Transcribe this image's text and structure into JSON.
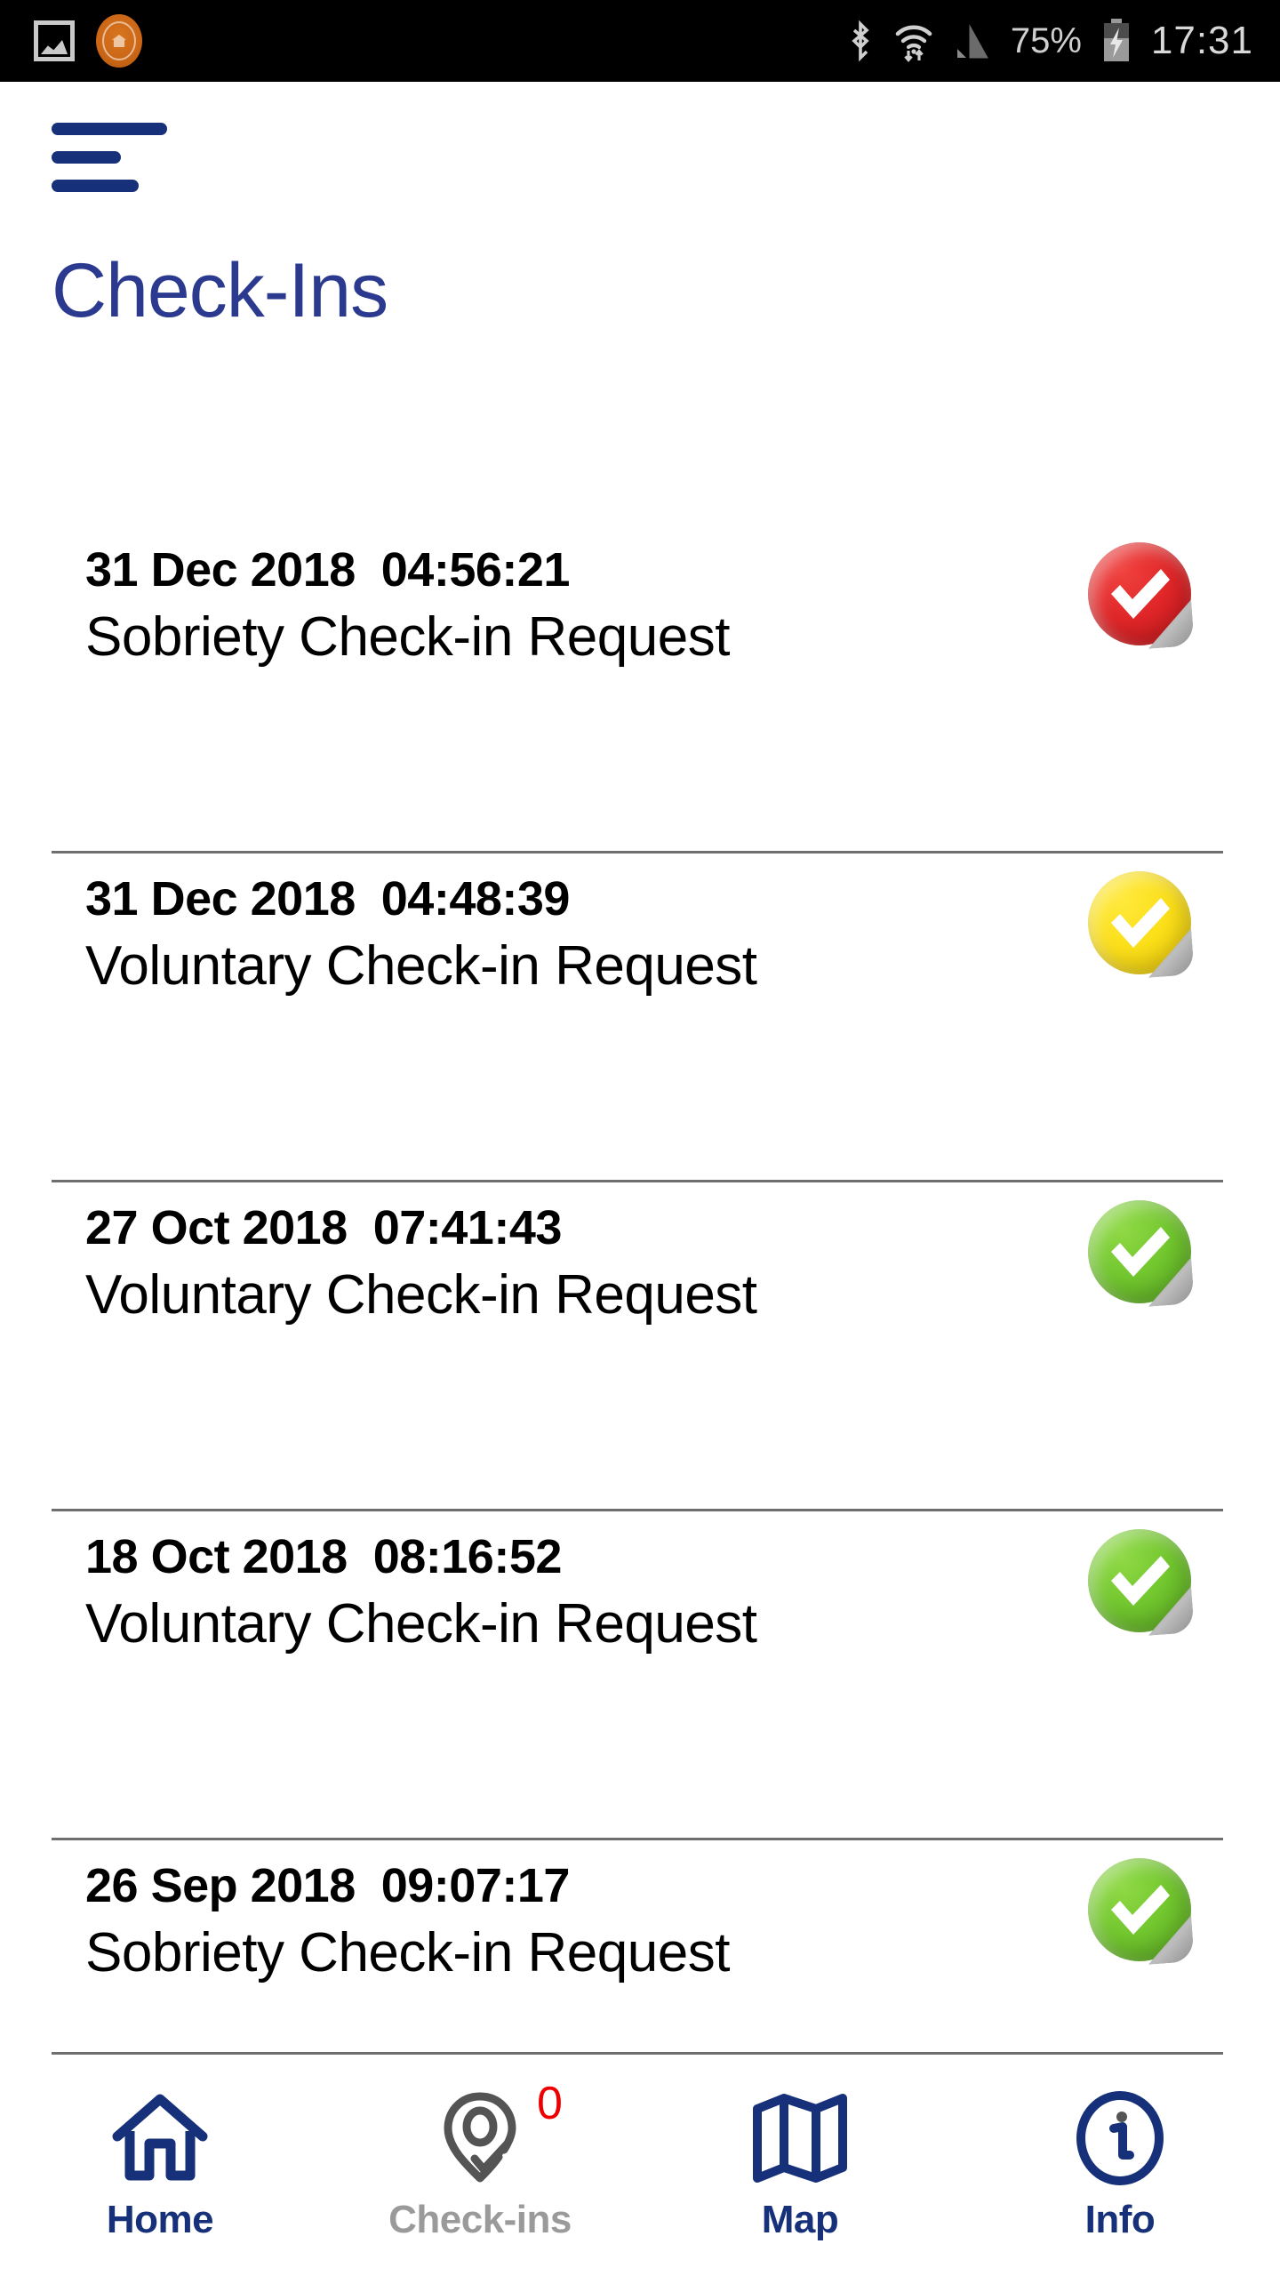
{
  "statusbar": {
    "battery_percent": "75%",
    "clock": "17:31",
    "icons": [
      "screenshot-icon",
      "ecell-logo-icon",
      "bluetooth-icon",
      "wifi-icon",
      "signal-icon",
      "battery-charging-icon"
    ],
    "colors": {
      "background": "#000000",
      "foreground": "#cfcfcf",
      "logo": "#c96515"
    }
  },
  "header": {
    "menu_icon": "hamburger-menu-icon",
    "title": "Check-Ins",
    "title_color": "#2b3a8f"
  },
  "list": {
    "items": [
      {
        "date": "31 Dec 2018  04:56:21",
        "title": "Sobriety Check-in Request",
        "status": "red",
        "status_color": "#e02628"
      },
      {
        "date": "31 Dec 2018  04:48:39",
        "title": "Voluntary Check-in Request",
        "status": "yellow",
        "status_color": "#fbdf19"
      },
      {
        "date": "27 Oct 2018  07:41:43",
        "title": "Voluntary Check-in Request",
        "status": "green",
        "status_color": "#72c62e"
      },
      {
        "date": "18 Oct 2018  08:16:52",
        "title": "Voluntary Check-in Request",
        "status": "green",
        "status_color": "#72c62e"
      },
      {
        "date": "26 Sep 2018  09:07:17",
        "title": "Sobriety Check-in Request",
        "status": "green",
        "status_color": "#72c62e"
      }
    ]
  },
  "bottomnav": {
    "active_color": "#16307a",
    "inactive_color": "#9a9a9a",
    "badge_color": "#ee0000",
    "items": [
      {
        "label": "Home",
        "icon": "home-icon",
        "state": "active"
      },
      {
        "label": "Check-ins",
        "icon": "map-pin-check-icon",
        "state": "inactive",
        "badge": "0"
      },
      {
        "label": "Map",
        "icon": "map-folded-icon",
        "state": "active"
      },
      {
        "label": "Info",
        "icon": "info-circle-icon",
        "state": "active"
      }
    ]
  }
}
